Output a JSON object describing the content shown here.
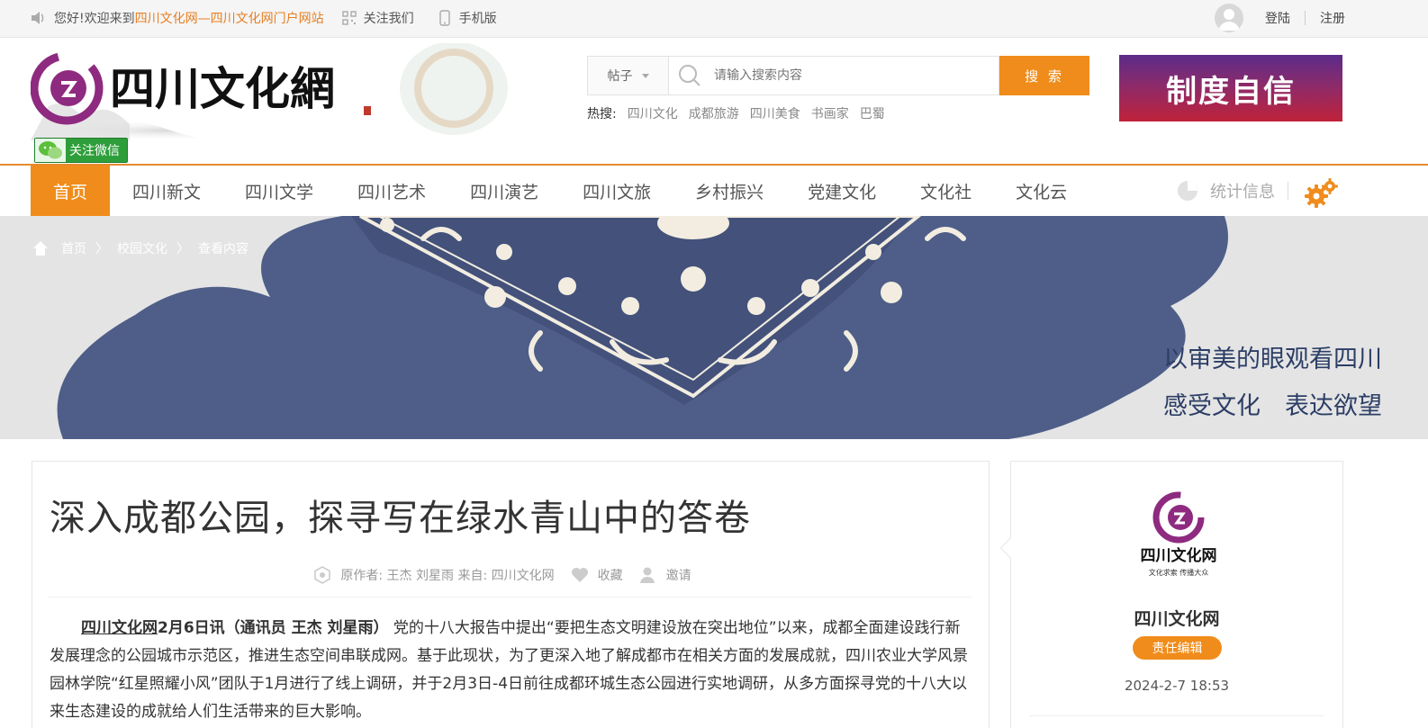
{
  "topbar": {
    "greeting": "您好!欢迎来到",
    "site_link": "四川文化网—四川文化网门户网站",
    "follow_us": "关注我们",
    "mobile": "手机版",
    "login": "登陆",
    "register": "注册"
  },
  "header": {
    "logo_text": "四川文化网",
    "wechat_follow": "关注微信",
    "search": {
      "type_selected": "帖子",
      "placeholder": "请输入搜索内容",
      "button": "搜 索"
    },
    "hot_label": "热搜:",
    "hot_terms": [
      "四川文化",
      "成都旅游",
      "四川美食",
      "书画家",
      "巴蜀"
    ],
    "ad_text": "制度自信"
  },
  "nav": {
    "items": [
      "首页",
      "四川新文",
      "四川文学",
      "四川艺术",
      "四川演艺",
      "四川文旅",
      "乡村振兴",
      "党建文化",
      "文化社",
      "文化云"
    ],
    "active_index": 0,
    "stats": "统计信息"
  },
  "hero": {
    "breadcrumb": [
      "首页",
      "校园文化",
      "查看内容"
    ],
    "slogan_line1": "以审美的眼观看四川",
    "slogan_line2": "感受文化　表达欲望"
  },
  "article": {
    "title": "深入成都公园，探寻写在绿水青山中的答卷",
    "meta": {
      "author": "原作者: 王杰 刘星雨 来自: 四川文化网",
      "favorite": "收藏",
      "invite": "邀请"
    },
    "body": {
      "source": "四川文化网",
      "lead": "2月6日讯（通讯员 王杰 刘星雨）",
      "text": "  党的十八大报告中提出“要把生态文明建设放在突出地位”以来，成都全面建设践行新发展理念的公园城市示范区，推进生态空间串联成网。基于此现状，为了更深入地了解成都市在相关方面的发展成就，四川农业大学风景园林学院“红星照耀小风”团队于1月进行了线上调研，并于2月3日-4日前往成都环城生态公园进行实地调研，从多方面探寻党的十八大以来生态建设的成就给人们生活带来的巨大影响。"
    }
  },
  "sidebar": {
    "logo_name": "四川文化网",
    "logo_tagline": "文化求索 传播大众",
    "name": "四川文化网",
    "badge": "责任编辑",
    "date": "2024-2-7 18:53"
  },
  "colors": {
    "accent": "#f08c1b",
    "brand_purple": "#8e2a7f",
    "slogan": "#2c3e66",
    "hero_blue": "#4e5e88"
  }
}
